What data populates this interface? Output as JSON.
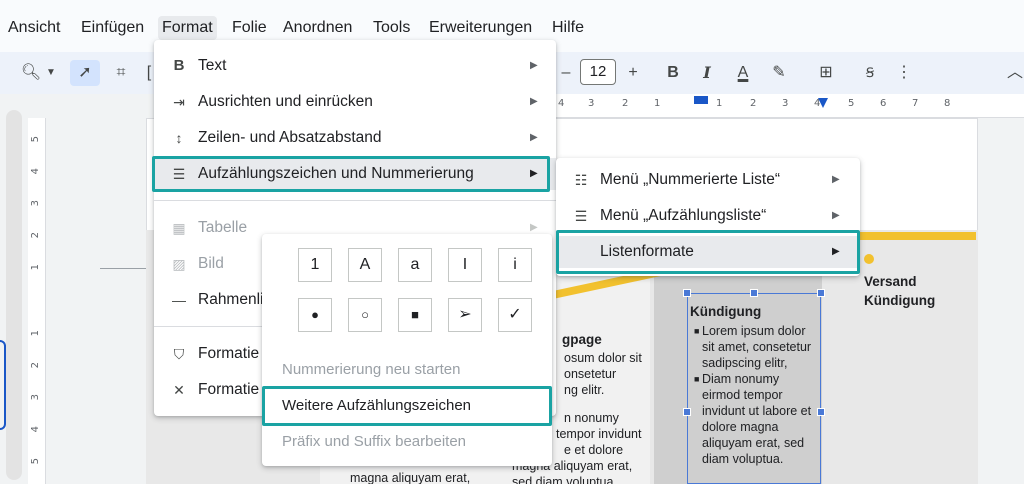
{
  "menubar": {
    "items": [
      "Ansicht",
      "Einfügen",
      "Format",
      "Folie",
      "Anordnen",
      "Tools",
      "Erweiterungen",
      "Hilfe"
    ],
    "active": "Format"
  },
  "toolbar": {
    "font_size": "12",
    "minus": "–",
    "plus": "+",
    "bold": "B",
    "italic": "I",
    "text_color": "A",
    "more": "⋮",
    "collapse": "︿"
  },
  "ruler_top": [
    "4",
    "3",
    "2",
    "1",
    "1",
    "2",
    "3",
    "4",
    "5",
    "6",
    "7",
    "8"
  ],
  "ruler_left": [
    "5",
    "4",
    "3",
    "2",
    "1",
    "1",
    "2",
    "3",
    "4",
    "5"
  ],
  "format_menu": {
    "items": [
      {
        "label": "Text",
        "icon": "bold-icon",
        "glyph": "B",
        "submenu": true,
        "disabled": false
      },
      {
        "label": "Ausrichten und einrücken",
        "icon": "indent-icon",
        "glyph": "⇥",
        "submenu": true,
        "disabled": false
      },
      {
        "label": "Zeilen- und Absatzabstand",
        "icon": "line-spacing-icon",
        "glyph": "↕",
        "submenu": true,
        "disabled": false
      },
      {
        "label": "Aufzählungszeichen und Nummerierung",
        "icon": "bullet-list-icon",
        "glyph": "☰",
        "submenu": true,
        "disabled": false
      },
      {
        "label": "Tabelle",
        "icon": "table-icon",
        "glyph": "▦",
        "submenu": true,
        "disabled": true
      },
      {
        "label": "Bild",
        "icon": "image-icon",
        "glyph": "▨",
        "submenu": false,
        "disabled": true
      },
      {
        "label": "Rahmenli",
        "icon": "border-line-icon",
        "glyph": "—",
        "submenu": false,
        "disabled": false
      },
      {
        "label": "Formatie",
        "icon": "paint-format-icon",
        "glyph": "⛉",
        "submenu": false,
        "disabled": false
      },
      {
        "label": "Formatie",
        "icon": "clear-format-icon",
        "glyph": "✕",
        "submenu": false,
        "disabled": false
      }
    ]
  },
  "list_submenu": {
    "items": [
      {
        "label": "Menü „Nummerierte Liste“",
        "icon": "numbered-list-icon",
        "glyph": "☷"
      },
      {
        "label": "Menü „Aufzählungsliste“",
        "icon": "bullet-list-icon",
        "glyph": "☰"
      },
      {
        "label": "Listenformate",
        "icon": "",
        "glyph": ""
      }
    ]
  },
  "list_formats": {
    "numbering": [
      "1",
      "A",
      "a",
      "I",
      "i"
    ],
    "bullets": [
      "●",
      "○",
      "■",
      "➢",
      "✓"
    ],
    "restart": "Nummerierung neu starten",
    "more_bullets": "Weitere Aufzählungszeichen",
    "prefix_suffix": "Präfix und Suffix bearbeiten"
  },
  "slide": {
    "col2_head": "gpage",
    "col2_lines": [
      "osum dolor sit",
      "onsetetur",
      "ng elitr."
    ],
    "col2b_lines": [
      "n nonumy",
      "tempor invidunt",
      "e et dolore",
      "magna aliquyam erat,",
      "sed diam voluptua."
    ],
    "col1_line": "magna aliquyam erat,",
    "textbox_head": "Kündigung",
    "textbox_lines": [
      "Lorem ipsum dolor",
      "sit amet, consetetur",
      "sadipscing elitr,",
      "Diam nonumy",
      "eirmod tempor",
      "invidunt ut labore et",
      "dolore magna",
      "aliquyam erat, sed",
      "diam voluptua."
    ],
    "col4_head": [
      "Versand",
      "Kündigung"
    ]
  },
  "colors": {
    "highlight": "#1aa3a3",
    "selection": "#4a79d6",
    "accent_yellow": "#f2c12e"
  }
}
